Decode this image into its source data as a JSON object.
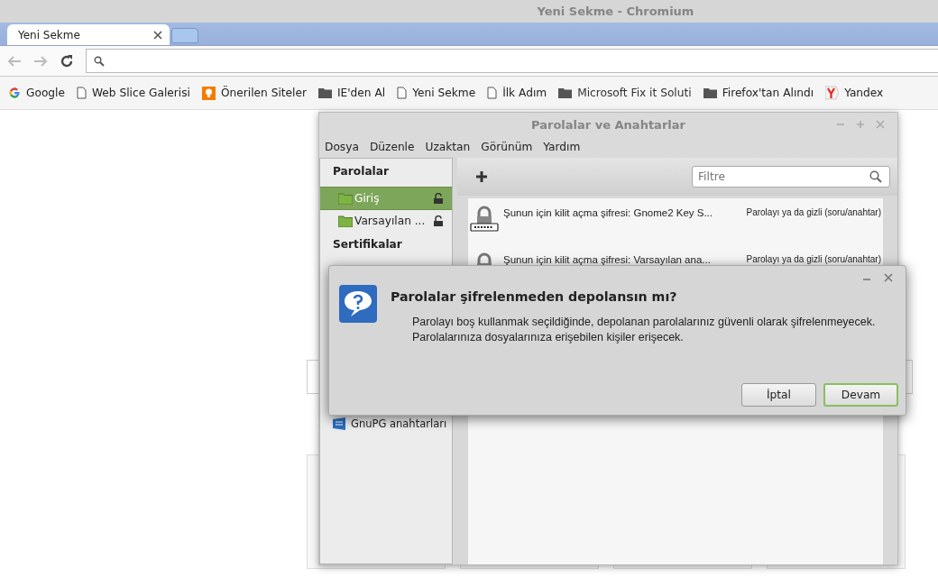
{
  "browser": {
    "title": "Yeni Sekme - Chromium",
    "tabs": [
      {
        "label": "Yeni Sekme",
        "selected": true
      }
    ],
    "bookmarks": [
      {
        "kind": "google",
        "label": "Google"
      },
      {
        "kind": "page",
        "label": "Web Slice Galerisi"
      },
      {
        "kind": "bulb",
        "label": "Önerilen Siteler"
      },
      {
        "kind": "folder",
        "label": "IE'den Al"
      },
      {
        "kind": "page",
        "label": "Yeni Sekme"
      },
      {
        "kind": "page",
        "label": "İlk Adım"
      },
      {
        "kind": "folder",
        "label": "Microsoft Fix it Soluti"
      },
      {
        "kind": "folder",
        "label": "Firefox'tan Alındı"
      },
      {
        "kind": "yandex",
        "label": "Yandex"
      }
    ]
  },
  "keyring_window": {
    "title": "Parolalar ve Anahtarlar",
    "menu": [
      "Dosya",
      "Düzenle",
      "Uzaktan",
      "Görünüm",
      "Yardım"
    ],
    "sidebar": [
      {
        "kind": "heading",
        "label": "Parolalar"
      },
      {
        "kind": "keyring",
        "label": "Giriş",
        "selected": true
      },
      {
        "kind": "keyring",
        "label": "Varsayılan ...",
        "selected": false
      },
      {
        "kind": "heading",
        "label": "Sertifikalar"
      },
      {
        "kind": "gnupg",
        "label": "GnuPG anahtarları",
        "selected": false
      }
    ],
    "filter": {
      "placeholder": "Filtre"
    },
    "items": [
      {
        "name": "Şunun için kilit açma şifresi: Gnome2 Key S...",
        "type": "Parolayı ya da gizli (soru/anahtar)"
      },
      {
        "name": "Şunun için kilit açma şifresi: Varsayılan ana...",
        "type": "Parolayı ya da gizli (soru/anahtar)"
      }
    ]
  },
  "dialog": {
    "title": "Parolalar şifrelenmeden depolansın mı?",
    "message": [
      "Parolayı boş kullanmak seçildiğinde, depolanan parolalarınız güvenli olarak şifrelenmeyecek.",
      "Parolalarınıza dosyalarınıza erişebilen kişiler erişecek."
    ],
    "buttons": [
      {
        "label": "İptal",
        "default": false
      },
      {
        "label": "Devam",
        "default": true
      }
    ]
  }
}
